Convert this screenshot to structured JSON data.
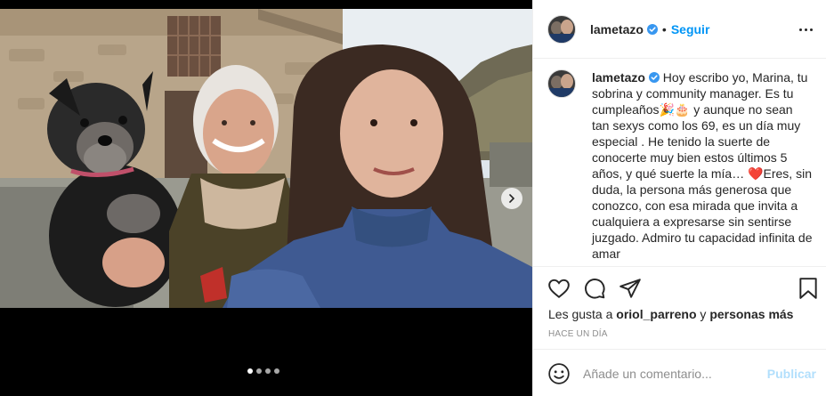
{
  "post": {
    "username": "lametazo",
    "separator": "•",
    "follow_label": "Seguir",
    "more_icon": "more-options-icon",
    "caption_username": "lametazo",
    "caption_text": " Hoy escribo yo, Marina, tu sobrina y community manager. Es tu cumpleaños🎉🎂 y aunque no sean tan sexys como los 69, es un día muy especial . He tenido la suerte de conocerte muy bien estos últimos 5 años, y qué suerte la mía… ❤️Eres, sin duda, la persona más generosa que conozco, con esa mirada que invita a cualquiera a expresarse sin sentirse juzgado. Admiro tu capacidad infinita de amar",
    "likes_prefix": "Les gusta a ",
    "likes_user": "oriol_parreno",
    "likes_middle": " y ",
    "likes_rest": "personas más",
    "time_ago": "HACE UN DÍA",
    "comment_placeholder": "Añade un comentario...",
    "publish_label": "Publicar"
  },
  "carousel": {
    "slide_count": 4,
    "active_slide": 1
  },
  "colors": {
    "link_blue": "#0095f6",
    "publish_disabled": "#b2dffc",
    "muted_text": "#8e8e8e",
    "verified_blue": "#3897f0"
  }
}
